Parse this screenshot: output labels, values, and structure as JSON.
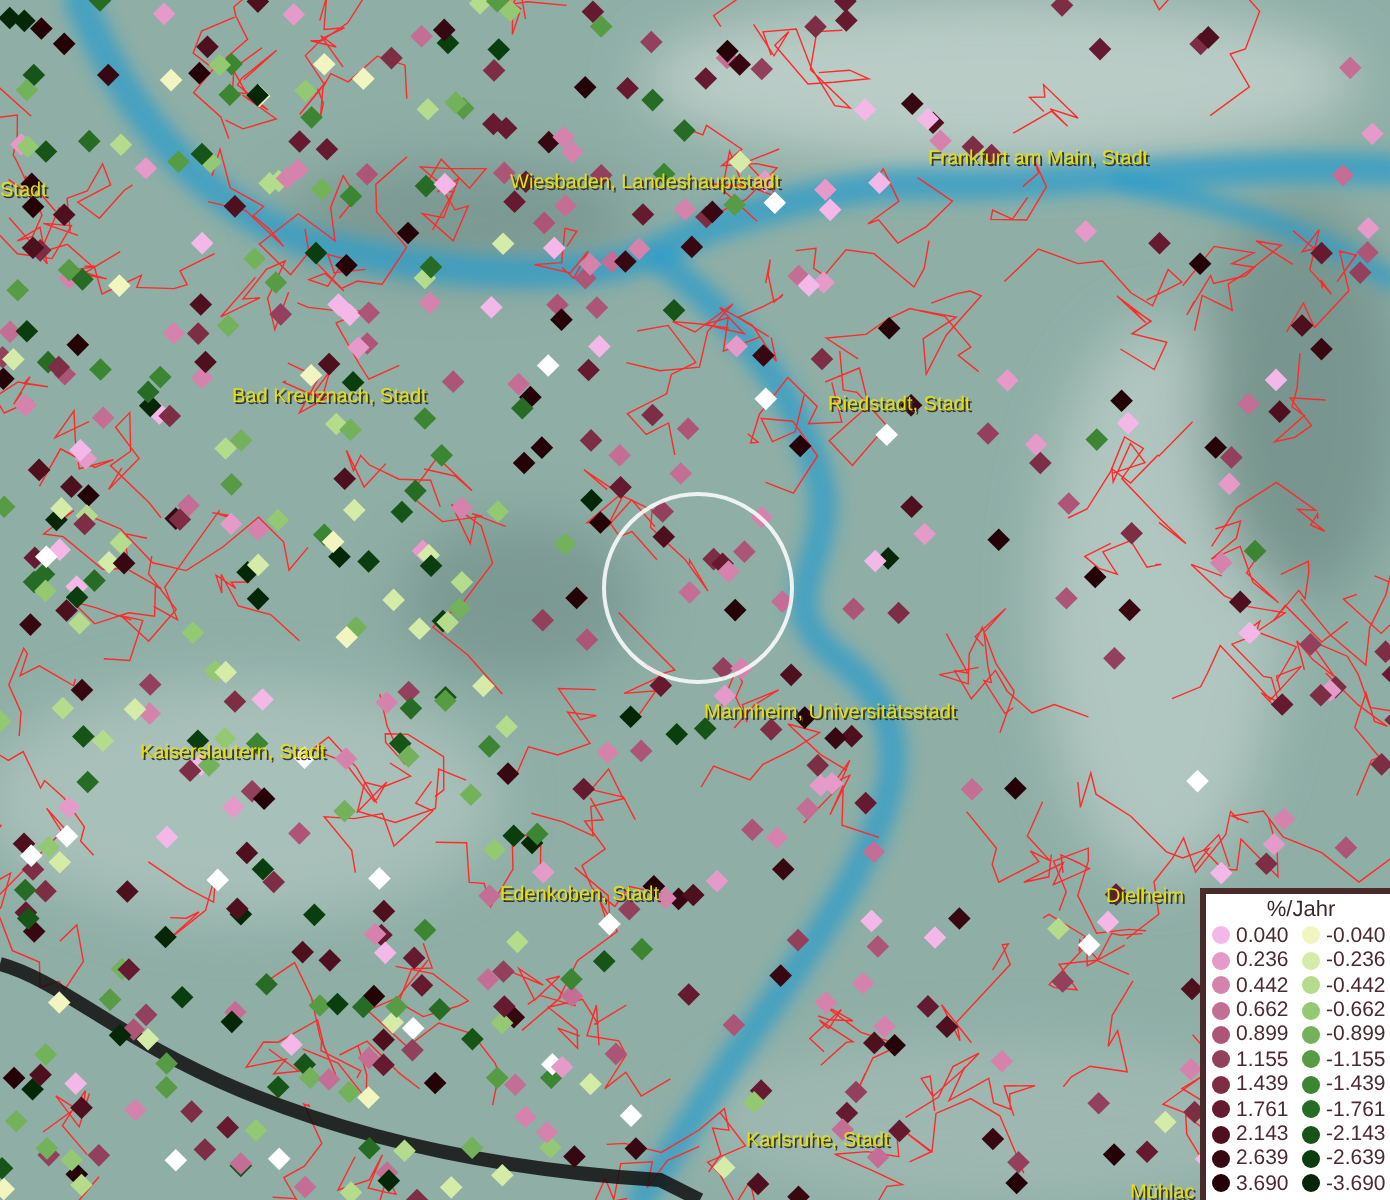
{
  "map": {
    "place_labels": [
      "Stadt",
      "Wiesbaden, Landeshauptstadt",
      "Frankfurt am Main, Stadt",
      "Bad Kreuznach, Stadt",
      "Riedstadt, Stadt",
      "Kaiserslautern, Stadt",
      "Mannheim, Universitätsstadt",
      "Edenkoben, Stadt",
      "Dielheim",
      "Karlsruhe, Stadt",
      "Mühlac"
    ]
  },
  "legend": {
    "title": "%/Jahr",
    "positive": [
      {
        "label": "0.040",
        "color": "#f4b8e8"
      },
      {
        "label": "0.236",
        "color": "#e59ac9"
      },
      {
        "label": "0.442",
        "color": "#d583ad"
      },
      {
        "label": "0.662",
        "color": "#c46e95"
      },
      {
        "label": "0.899",
        "color": "#ad5577"
      },
      {
        "label": "1.155",
        "color": "#93405c"
      },
      {
        "label": "1.439",
        "color": "#7d2e45"
      },
      {
        "label": "1.761",
        "color": "#651a30"
      },
      {
        "label": "2.143",
        "color": "#4e0f1f"
      },
      {
        "label": "2.639",
        "color": "#380812"
      },
      {
        "label": "3.690",
        "color": "#240208"
      }
    ],
    "negative": [
      {
        "label": "-0.040",
        "color": "#f2f5c0"
      },
      {
        "label": "-0.236",
        "color": "#d5eba8"
      },
      {
        "label": "-0.442",
        "color": "#b5dc8c"
      },
      {
        "label": "-0.662",
        "color": "#94c873"
      },
      {
        "label": "-0.899",
        "color": "#73b25a"
      },
      {
        "label": "-1.155",
        "color": "#579b45"
      },
      {
        "label": "-1.439",
        "color": "#3c8533"
      },
      {
        "label": "-1.761",
        "color": "#276c24"
      },
      {
        "label": "-2.143",
        "color": "#165417"
      },
      {
        "label": "-2.639",
        "color": "#0b3e0e"
      },
      {
        "label": "-3.690",
        "color": "#052708"
      }
    ]
  }
}
